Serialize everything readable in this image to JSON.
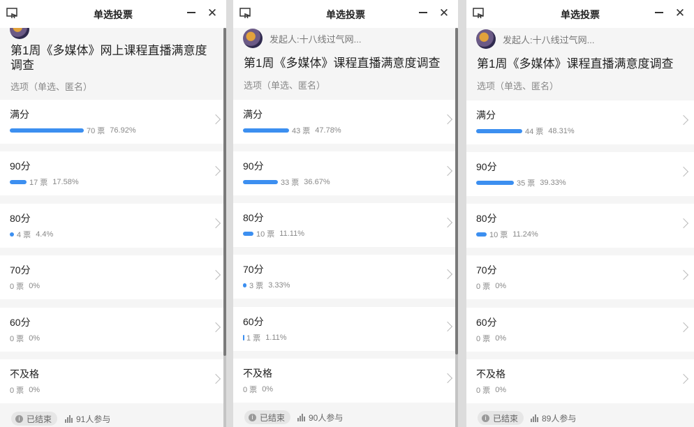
{
  "panels": [
    {
      "window_title": "单选投票",
      "close_glyph": "✕",
      "initiator": "",
      "poll_title": "第1周《多媒体》网上课程直播满意度调查",
      "meta": "选项（单选、匿名）",
      "options": [
        {
          "label": "满分",
          "votes": "70 票",
          "percent": "76.92%"
        },
        {
          "label": "90分",
          "votes": "17 票",
          "percent": "17.58%"
        },
        {
          "label": "80分",
          "votes": "4 票",
          "percent": "4.4%"
        },
        {
          "label": "70分",
          "votes": "0 票",
          "percent": "0%"
        },
        {
          "label": "60分",
          "votes": "0 票",
          "percent": "0%"
        },
        {
          "label": "不及格",
          "votes": "0 票",
          "percent": "0%"
        }
      ],
      "status": "已结束",
      "participants": "91人参与"
    },
    {
      "window_title": "单选投票",
      "close_glyph": "✕",
      "initiator": "发起人:十八线过气网...",
      "poll_title": "第1周《多媒体》课程直播满意度调查",
      "meta": "选项（单选、匿名）",
      "options": [
        {
          "label": "满分",
          "votes": "43 票",
          "percent": "47.78%"
        },
        {
          "label": "90分",
          "votes": "33 票",
          "percent": "36.67%"
        },
        {
          "label": "80分",
          "votes": "10 票",
          "percent": "11.11%"
        },
        {
          "label": "70分",
          "votes": "3 票",
          "percent": "3.33%"
        },
        {
          "label": "60分",
          "votes": "1 票",
          "percent": "1.11%"
        },
        {
          "label": "不及格",
          "votes": "0 票",
          "percent": "0%"
        }
      ],
      "status": "已结束",
      "participants": "90人参与"
    },
    {
      "window_title": "单选投票",
      "close_glyph": "✕",
      "initiator": "发起人:十八线过气网...",
      "poll_title": "第1周《多媒体》课程直播满意度调查",
      "meta": "选项（单选、匿名）",
      "options": [
        {
          "label": "满分",
          "votes": "44 票",
          "percent": "48.31%"
        },
        {
          "label": "90分",
          "votes": "35 票",
          "percent": "39.33%"
        },
        {
          "label": "80分",
          "votes": "10 票",
          "percent": "11.24%"
        },
        {
          "label": "70分",
          "votes": "0 票",
          "percent": "0%"
        },
        {
          "label": "60分",
          "votes": "0 票",
          "percent": "0%"
        },
        {
          "label": "不及格",
          "votes": "0 票",
          "percent": "0%"
        }
      ],
      "status": "已结束",
      "participants": "89人参与"
    }
  ],
  "icons": {
    "window": "poll-window-icon",
    "minimize": "minimize-icon",
    "close": "close-icon",
    "chevron": "chevron-right-icon",
    "status": "info-icon",
    "participants": "bar-chart-icon"
  },
  "colors": {
    "bar": "#3c8ff0",
    "card": "#ffffff",
    "background": "#f5f5f5"
  }
}
